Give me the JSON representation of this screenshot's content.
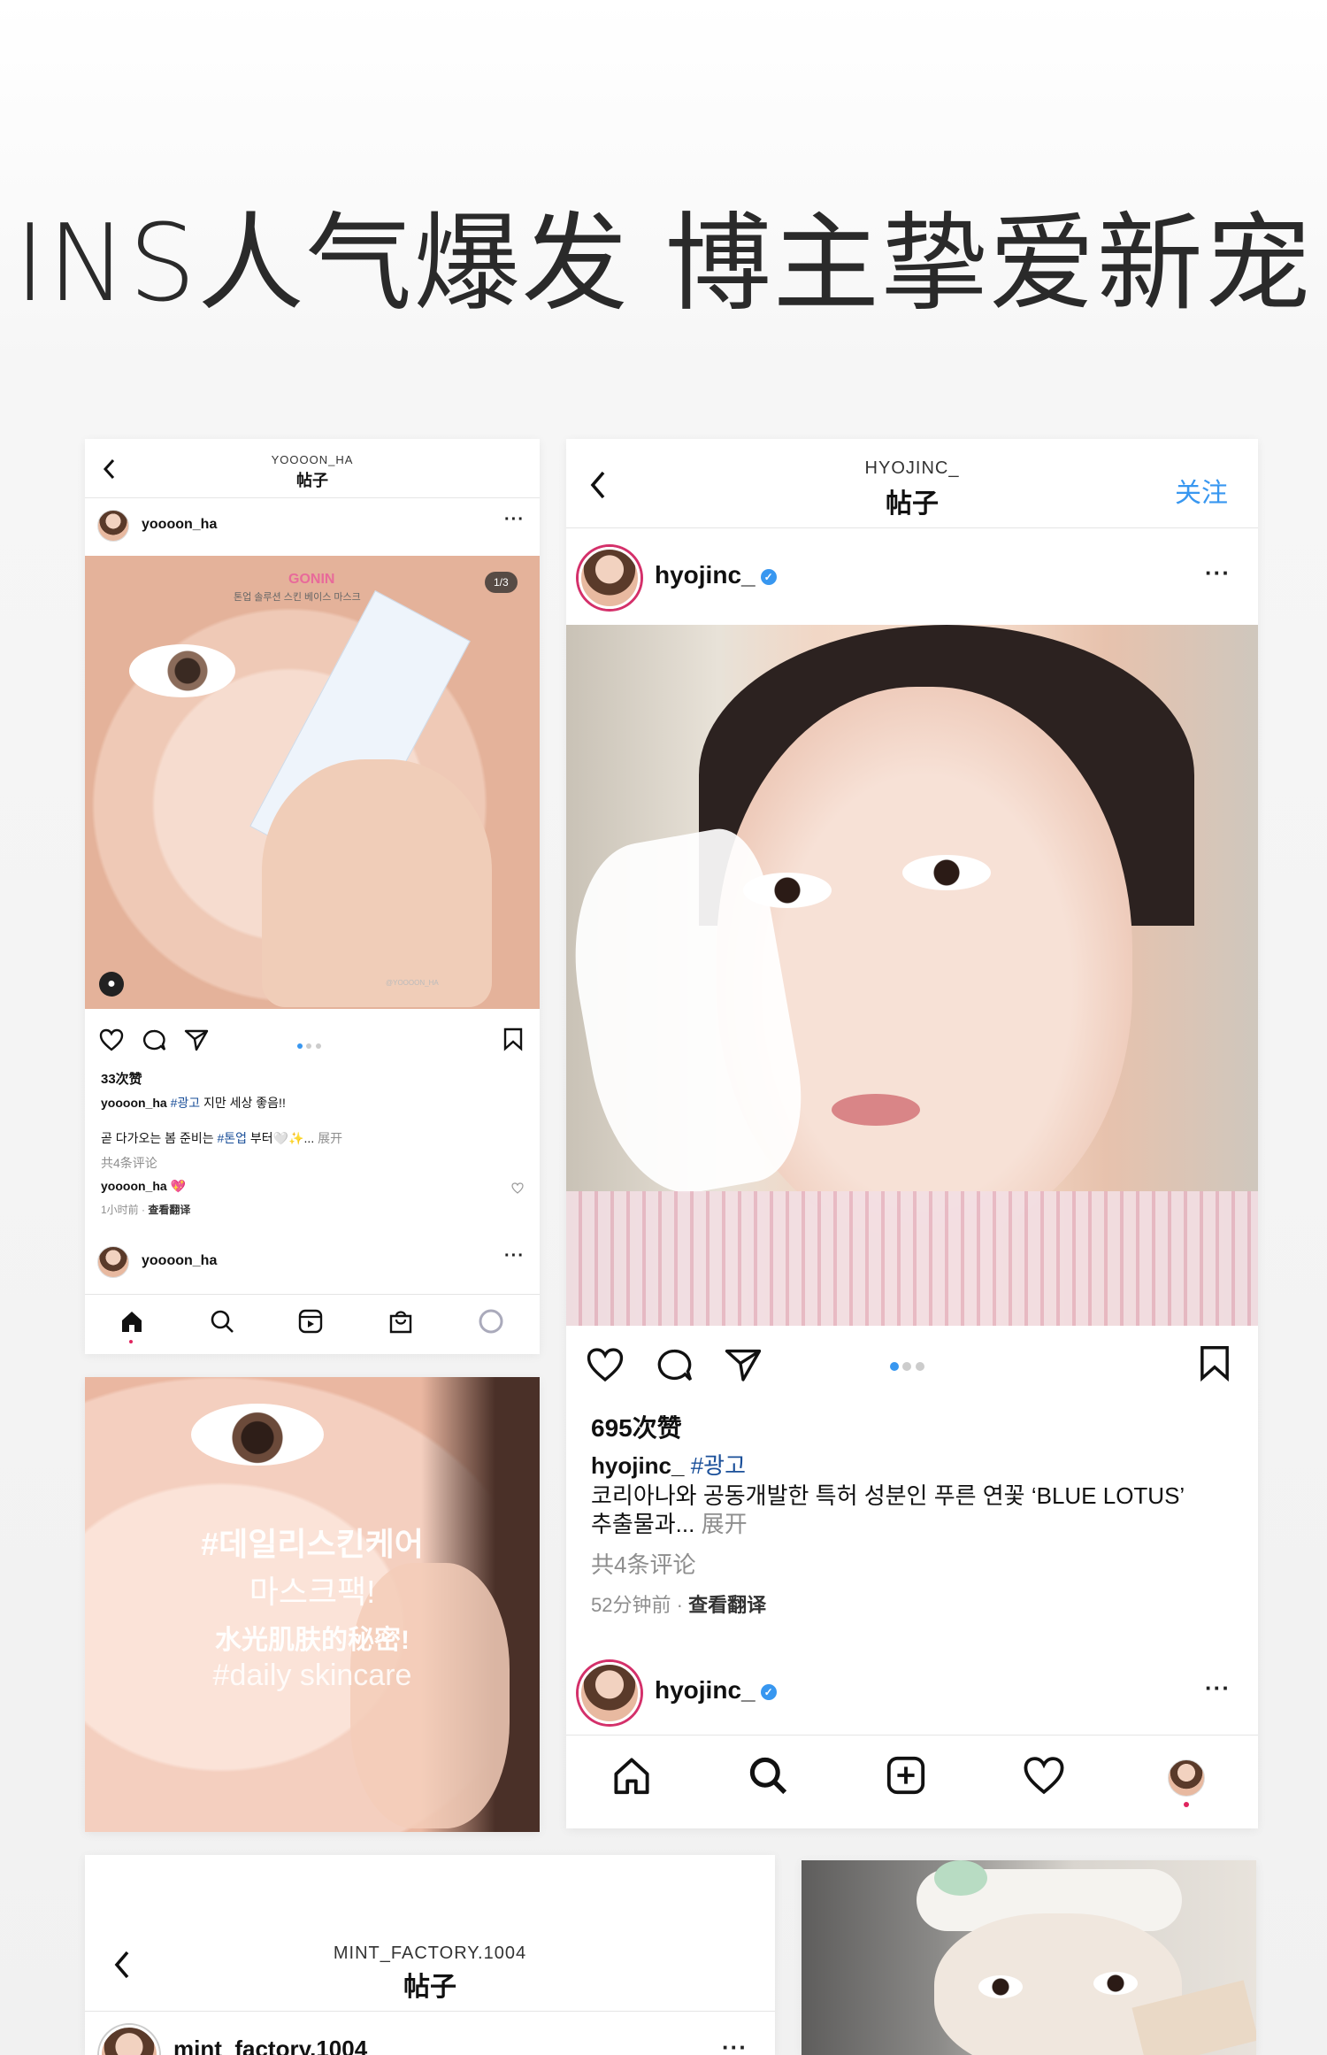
{
  "headline": "INS人气爆发 博主挚爱新宠",
  "card_left": {
    "handle_upper": "YOOOON_HA",
    "page_title": "帖子",
    "username": "yoooon_ha",
    "photo_counter": "1/3",
    "brand_text": "GONIN",
    "brand_sub": "톤업 솔루션 스킨 베이스 마스크",
    "watermark": "@YOOOON_HA",
    "likes": "33次赞",
    "caption_user": "yoooon_ha",
    "caption_tag": "#광고",
    "caption_text": "지만 세상 좋음!!",
    "caption_line2_a": "곧 다가오는 봄 준비는",
    "caption_line2_tag": "#톤업",
    "caption_line2_b": "부터🤍✨...",
    "more": "展开",
    "comments": "共4条评论",
    "reply_user": "yoooon_ha",
    "reply_emoji": "💖",
    "time": "1小时前",
    "translate": "查看翻译",
    "next_user": "yoooon_ha"
  },
  "promo_tile": {
    "line1": "#데일리스킨케어",
    "line2": "마스크팩!",
    "line3": "水光肌肤的秘密!",
    "line4": "#daily skincare"
  },
  "card_right": {
    "handle_upper": "HYOJINC_",
    "page_title": "帖子",
    "follow": "关注",
    "username": "hyojinc_",
    "likes": "695次赞",
    "caption_user": "hyojinc_",
    "caption_tag": "#광고",
    "caption_text": "코리아나와 공동개발한 특허 성분인 푸른 연꽃 ‘BLUE LOTUS’",
    "caption_text2": "추출물과...",
    "more": "展开",
    "comments": "共4条评论",
    "time": "52分钟前",
    "translate": "查看翻译",
    "next_user": "hyojinc_"
  },
  "card_bottom": {
    "handle_upper": "MINT_FACTORY.1004",
    "page_title": "帖子",
    "username": "mint_factory.1004"
  },
  "colors": {
    "link_blue": "#3897f0",
    "hashtag": "#1a4f99",
    "gray": "#8e8e8e"
  }
}
